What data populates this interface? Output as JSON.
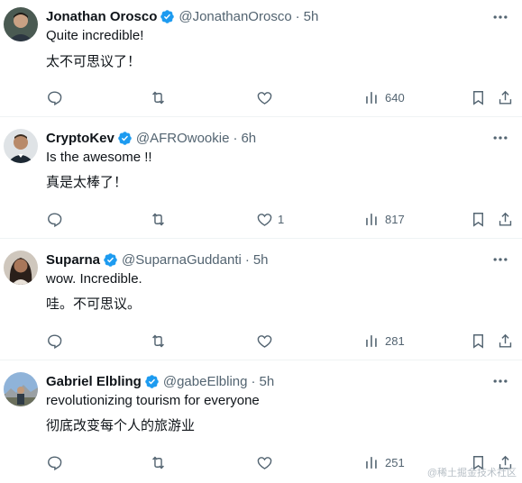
{
  "tweets": [
    {
      "name": "Jonathan Orosco",
      "handle": "@JonathanOrosco",
      "time": "5h",
      "text_en": "Quite incredible!",
      "text_zh": "太不可思议了！",
      "likes": "",
      "views": "640"
    },
    {
      "name": "CryptoKev",
      "handle": "@AFROwookie",
      "time": "6h",
      "text_en": "Is the awesome !!",
      "text_zh": "真是太棒了！",
      "likes": "1",
      "views": "817"
    },
    {
      "name": "Suparna",
      "handle": "@SuparnaGuddanti",
      "time": "5h",
      "text_en": "wow. Incredible.",
      "text_zh": "哇。不可思议。",
      "likes": "",
      "views": "281"
    },
    {
      "name": "Gabriel Elbling",
      "handle": "@gabeElbling",
      "time": "5h",
      "text_en": "revolutionizing tourism for everyone",
      "text_zh": "彻底改变每个人的旅游业",
      "likes": "",
      "views": "251"
    }
  ],
  "separator": "·",
  "watermark": "@稀土掘金技术社区",
  "colors": {
    "verified": "#1d9bf0",
    "muted": "#536471",
    "text": "#0f1419",
    "divider": "#eff3f4"
  },
  "icons": [
    "verified-badge-icon",
    "more-icon",
    "reply-icon",
    "retweet-icon",
    "like-icon",
    "views-icon",
    "bookmark-icon",
    "share-icon"
  ]
}
